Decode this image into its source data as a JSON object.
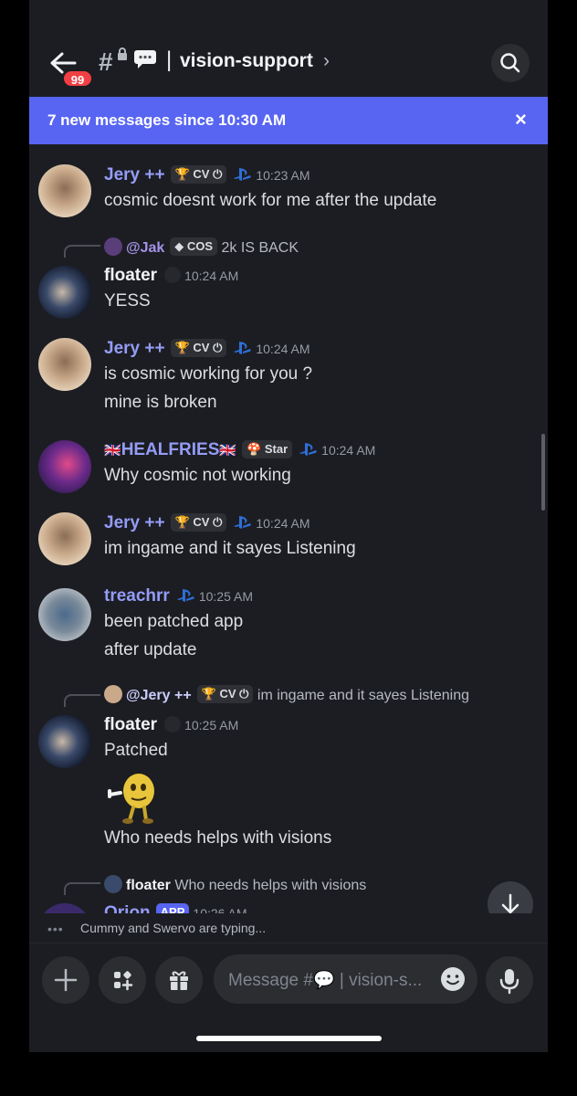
{
  "header": {
    "back_badge": "99",
    "channel_name": "vision-support",
    "separator": "|",
    "chevron": "›"
  },
  "banner": {
    "text": "7 new messages since 10:30 AM",
    "close": "×"
  },
  "messages": [
    {
      "author": "Jery ++",
      "tag": "CV",
      "time": "10:23 AM",
      "lines": [
        "cosmic doesnt work for me after the update"
      ]
    },
    {
      "reply_to": "@Jak",
      "reply_tag": "COS",
      "reply_text": "2k IS BACK",
      "author": "floater",
      "time": "10:24 AM",
      "lines": [
        "YESS"
      ]
    },
    {
      "author": "Jery ++",
      "tag": "CV",
      "time": "10:24 AM",
      "lines": [
        "is cosmic working for you ?",
        "mine is broken"
      ]
    },
    {
      "author": "HEALFRIES",
      "tag": "Star",
      "time": "10:24 AM",
      "lines": [
        "Why cosmic not working"
      ]
    },
    {
      "author": "Jery ++",
      "tag": "CV",
      "time": "10:24 AM",
      "lines": [
        "im ingame and it sayes Listening"
      ]
    },
    {
      "author": "treachrr",
      "time": "10:25 AM",
      "lines": [
        "been patched app",
        "after update"
      ]
    },
    {
      "reply_to": "@Jery ++",
      "reply_tag": "CV",
      "reply_text": "im ingame and it sayes Listening",
      "author": "floater",
      "time": "10:25 AM",
      "lines": [
        "Patched",
        "Who needs helps with visions"
      ]
    },
    {
      "reply_to": "floater",
      "reply_text": "Who needs helps with visions",
      "author": "Orion",
      "tag": "APP",
      "time": "10:26 AM"
    }
  ],
  "typing": {
    "text": "Cummy and Swervo are typing..."
  },
  "composer": {
    "placeholder": "Message #💬 | vision-s..."
  },
  "colors": {
    "blurple": "#5865f2",
    "name_blue": "#949cf7",
    "bg": "#1c1d22",
    "danger": "#f23f43"
  },
  "icons": [
    "back-arrow-icon",
    "hash-icon",
    "search-icon",
    "close-icon",
    "playstation-icon",
    "trophy-icon",
    "scroll-down-icon",
    "plus-icon",
    "apps-icon",
    "gift-icon",
    "emoji-icon",
    "microphone-icon"
  ]
}
